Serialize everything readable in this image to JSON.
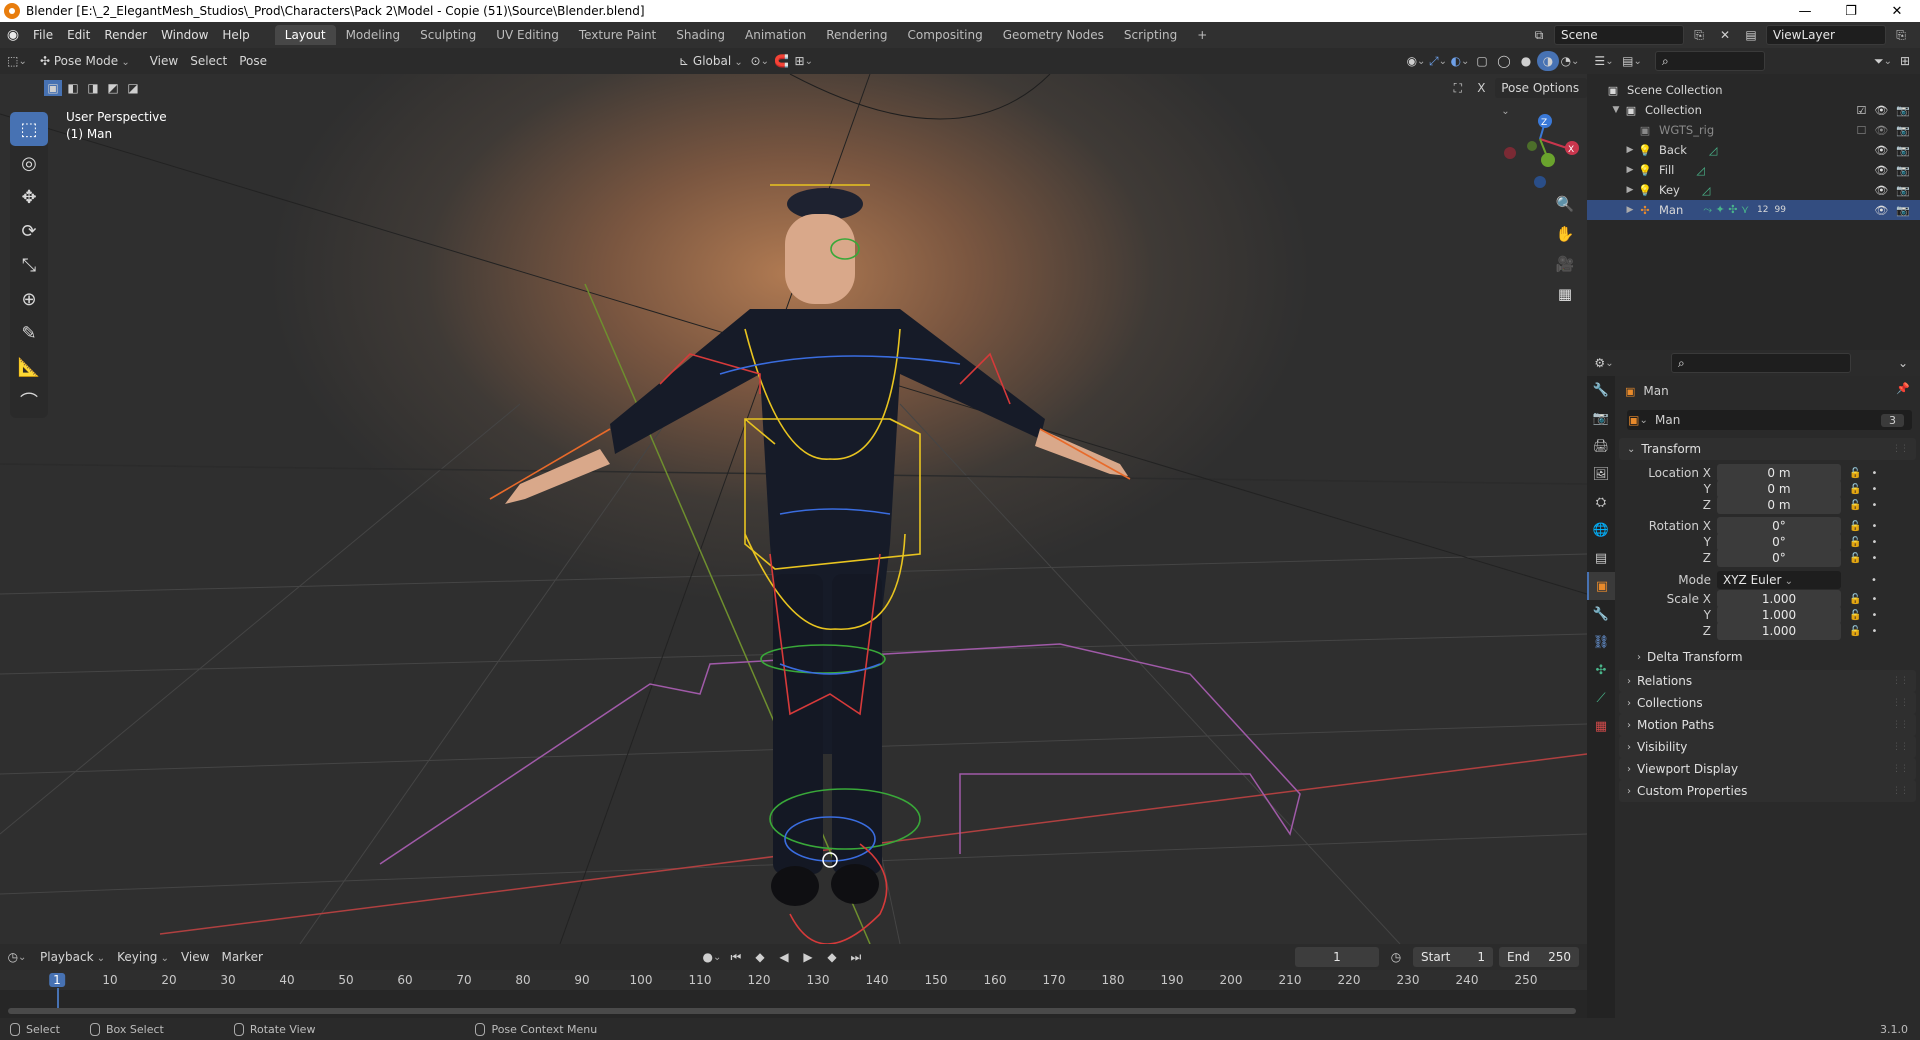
{
  "window": {
    "title": "Blender [E:\\_2_ElegantMesh_Studios\\_Prod\\Characters\\Pack 2\\Model - Copie (51)\\Source\\Blender.blend]",
    "controls": [
      "—",
      "❐",
      "✕"
    ]
  },
  "menubar": {
    "menus": [
      "File",
      "Edit",
      "Render",
      "Window",
      "Help"
    ],
    "workspaces": [
      "Layout",
      "Modeling",
      "Sculpting",
      "UV Editing",
      "Texture Paint",
      "Shading",
      "Animation",
      "Rendering",
      "Compositing",
      "Geometry Nodes",
      "Scripting"
    ],
    "active_workspace": "Layout",
    "add_tab": "+",
    "scene": "Scene",
    "view_layer": "ViewLayer"
  },
  "viewport_header": {
    "mode": "Pose Mode",
    "menus": [
      "View",
      "Select",
      "Pose"
    ],
    "orientation": "Global",
    "pose_options": "Pose Options"
  },
  "viewport": {
    "perspective": "User Perspective",
    "object_info": "(1) Man",
    "gizmo_axes": [
      "Z",
      "Y",
      "X"
    ]
  },
  "outliner": {
    "scene_collection": "Scene Collection",
    "items": [
      {
        "label": "Collection",
        "level": 1
      },
      {
        "label": "WGTS_rig",
        "level": 2
      },
      {
        "label": "Back",
        "level": 2
      },
      {
        "label": "Fill",
        "level": 2
      },
      {
        "label": "Key",
        "level": 2
      },
      {
        "label": "Man",
        "level": 2,
        "badge": "12",
        "badge2": "99"
      }
    ]
  },
  "properties": {
    "object_name": "Man",
    "datablock_name": "Man",
    "datablock_users": "3",
    "transform_label": "Transform",
    "location_label": "Location X",
    "rotation_label": "Rotation X",
    "scale_label": "Scale X",
    "axis_y": "Y",
    "axis_z": "Z",
    "location": [
      "0 m",
      "0 m",
      "0 m"
    ],
    "rotation": [
      "0°",
      "0°",
      "0°"
    ],
    "mode_label": "Mode",
    "mode_value": "XYZ Euler",
    "scale": [
      "1.000",
      "1.000",
      "1.000"
    ],
    "panels": [
      "Delta Transform",
      "Relations",
      "Collections",
      "Motion Paths",
      "Visibility",
      "Viewport Display",
      "Custom Properties"
    ]
  },
  "timeline": {
    "menus": [
      "Playback",
      "Keying",
      "View",
      "Marker"
    ],
    "current_frame": "1",
    "start_label": "Start",
    "start": "1",
    "end_label": "End",
    "end": "250",
    "ruler": [
      "1",
      "10",
      "20",
      "30",
      "40",
      "50",
      "60",
      "70",
      "80",
      "90",
      "100",
      "110",
      "120",
      "130",
      "140",
      "150",
      "160",
      "170",
      "180",
      "190",
      "200",
      "210",
      "220",
      "230",
      "240",
      "250"
    ]
  },
  "statusbar": {
    "items": [
      "Select",
      "Box Select",
      "Rotate View",
      "Pose Context Menu"
    ],
    "version": "3.1.0"
  }
}
